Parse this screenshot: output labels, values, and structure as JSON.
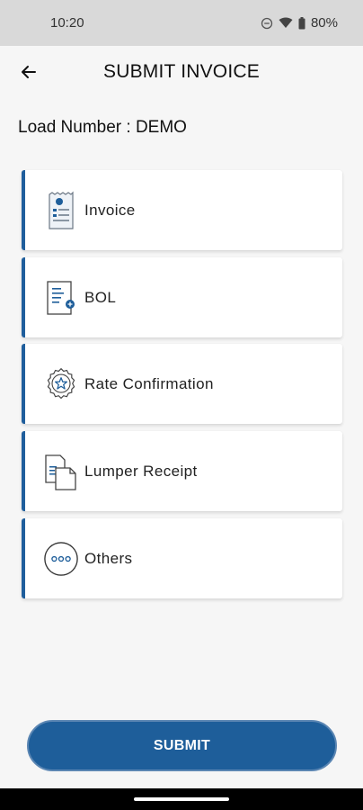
{
  "status": {
    "time": "10:20",
    "battery": "80%"
  },
  "header": {
    "title": "SUBMIT INVOICE"
  },
  "load": {
    "text": "Load Number : DEMO"
  },
  "documents": [
    {
      "label": "Invoice",
      "icon": "invoice-icon"
    },
    {
      "label": "BOL",
      "icon": "bol-document-icon"
    },
    {
      "label": "Rate Confirmation",
      "icon": "rate-badge-icon"
    },
    {
      "label": "Lumper Receipt",
      "icon": "receipt-icon"
    },
    {
      "label": "Others",
      "icon": "more-dots-icon"
    }
  ],
  "submit": {
    "label": "SUBMIT"
  },
  "colors": {
    "accent": "#1e5e9a",
    "card_border": "#1f5e9c",
    "statusbar": "#d9d9d9"
  }
}
